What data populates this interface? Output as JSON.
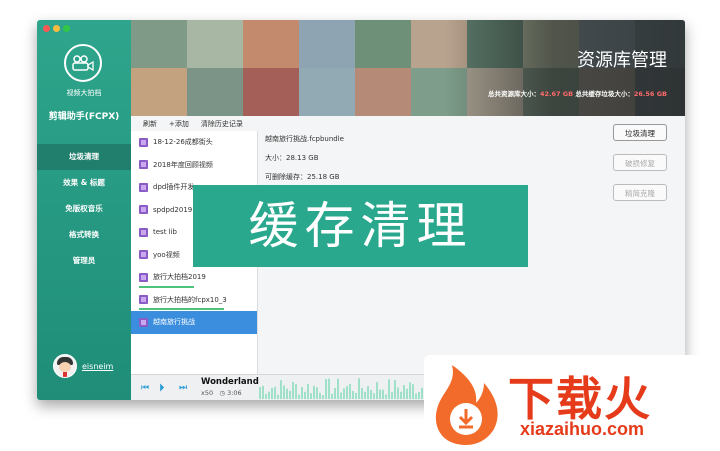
{
  "sidebar": {
    "brand_small": "视频大拍档",
    "brand_big": "剪辑助手(FCPX)",
    "items": [
      {
        "label": "垃圾清理",
        "active": true
      },
      {
        "label": "效果 & 标题"
      },
      {
        "label": "免版权音乐"
      },
      {
        "label": "格式转换"
      },
      {
        "label": "管理员"
      }
    ],
    "username": "eisneim"
  },
  "banner": {
    "title": "资源库管理",
    "stats_prefix": "总共资源库大小：",
    "library_size": "42.67 GB",
    "stats_middle": " 总共缓存垃圾大小：",
    "cache_size": "26.56 GB"
  },
  "toolbar": {
    "refresh": "刷新",
    "add": "+添加",
    "clear_history": "清除历史记录"
  },
  "list": [
    {
      "label": "18-12-26成都街头"
    },
    {
      "label": "2018年度回顾视频"
    },
    {
      "label": "dpd插件开发"
    },
    {
      "label": "spdpd2019"
    },
    {
      "label": "test lib"
    },
    {
      "label": "yoo视频"
    },
    {
      "label": "旅行大拍档2019",
      "progress": 0.55
    },
    {
      "label": "旅行大拍档的fcpx10_3",
      "progress": 0.85
    },
    {
      "label": "越南旅行挑战",
      "selected": true
    }
  ],
  "detail": {
    "filename": "越南旅行挑战.fcpbundle",
    "size": "大小：28.13 GB",
    "deletable": "可删除缓存：25.18 GB"
  },
  "buttons": {
    "clean": "垃圾清理",
    "repair": "破损修复",
    "slim": "精简克隆"
  },
  "player": {
    "song": "Wonderland",
    "speed": "x50",
    "duration": "3:06"
  },
  "overlay": {
    "text": "缓存清理"
  },
  "watermark": {
    "text": "下载火",
    "url": "xiazaihuo.com"
  },
  "colors": {
    "sidebar": "#2ea58c",
    "accent": "#3b8ede",
    "alert": "#ff6b6b",
    "watermark": "#e53b1a"
  }
}
